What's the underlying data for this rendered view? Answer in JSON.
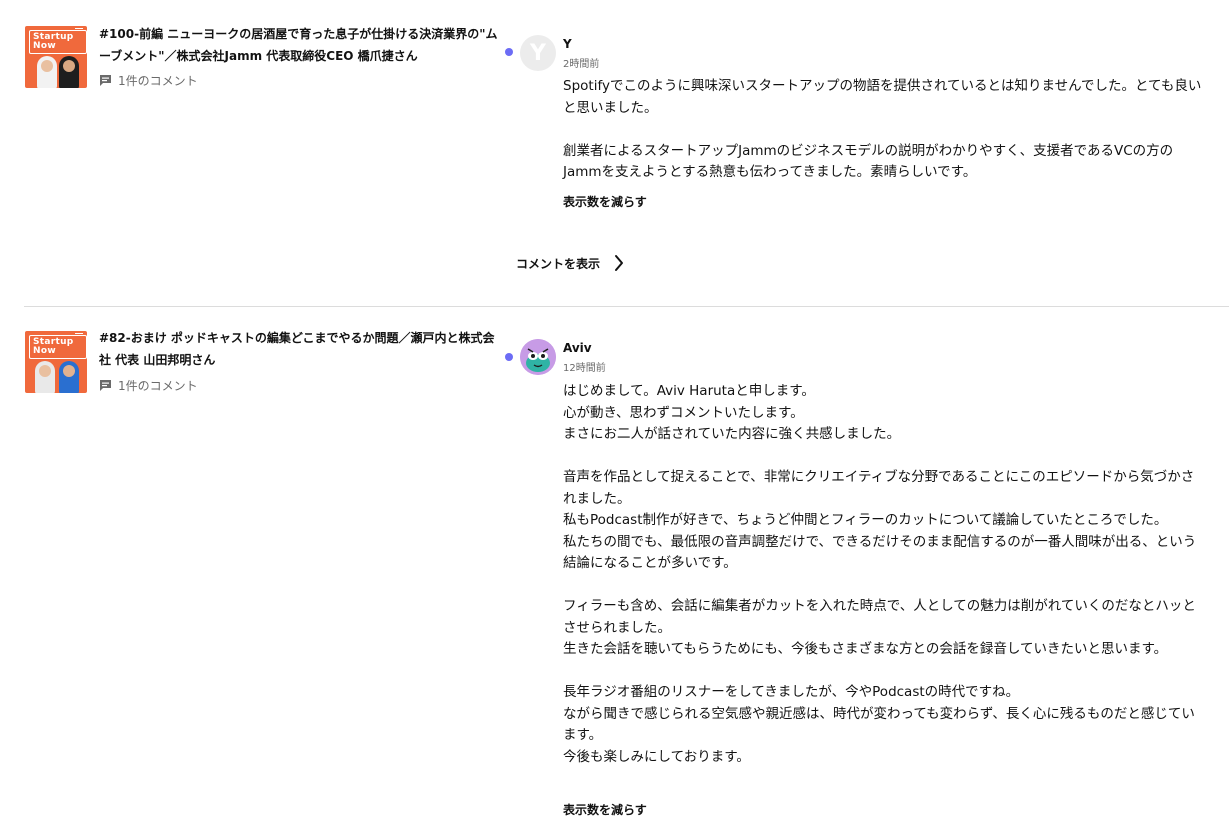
{
  "entries": [
    {
      "episode": {
        "badge": "Startup Now",
        "title": "#100-前編 ニューヨークの居酒屋で育った息子が仕掛ける決済業界の\"ムーブメント\"／株式会社Jamm 代表取締役CEO 橋爪捷さん",
        "comments_count": "1件のコメント"
      },
      "comment": {
        "avatar_letter": "Y",
        "author": "Y",
        "time": "2時間前",
        "paragraphs": [
          "Spotifyでこのように興味深いスタートアップの物語を提供されているとは知りませんでした。とても良いと思いました。",
          "創業者によるスタートアップJammのビジネスモデルの説明がわかりやすく、支援者であるVCの方のJammを支えようとする熱意も伝わってきました。素晴らしいです。"
        ],
        "show_less": "表示数を減らす"
      },
      "show_comments": "コメントを表示"
    },
    {
      "episode": {
        "badge": "Startup Now",
        "title": "#82-おまけ ポッドキャストの編集どこまでやるか問題／瀬戸内と株式会社 代表 山田邦明さん",
        "comments_count": "1件のコメント"
      },
      "comment": {
        "author": "Aviv",
        "time": "12時間前",
        "paragraphs": [
          "はじめまして。Aviv Harutaと申します。",
          "心が動き、思わずコメントいたします。",
          "まさにお二人が話されていた内容に強く共感しました。",
          "",
          "音声を作品として捉えることで、非常にクリエイティブな分野であることにこのエピソードから気づかされました。",
          "私もPodcast制作が好きで、ちょうど仲間とフィラーのカットについて議論していたところでした。",
          "私たちの間でも、最低限の音声調整だけで、できるだけそのまま配信するのが一番人間味が出る、という結論になることが多いです。",
          "",
          "フィラーも含め、会話に編集者がカットを入れた時点で、人としての魅力は削がれていくのだなとハッとさせられました。",
          "生きた会話を聴いてもらうためにも、今後もさまざまな方との会話を録音していきたいと思います。",
          "",
          "長年ラジオ番組のリスナーをしてきましたが、今やPodcastの時代ですね。",
          "ながら聞きで感じられる空気感や親近感は、時代が変わっても変わらず、長く心に残るものだと感じています。",
          "今後も楽しみにしております。"
        ],
        "show_less": "表示数を減らす"
      }
    }
  ],
  "colors": {
    "accent_dot": "#6c6cf5",
    "thumbnail_bg": "#f0693c",
    "divider": "#dcdcdc"
  },
  "icons": {
    "comment": "comment-bubble-icon",
    "chevron": "chevron-right-icon"
  }
}
